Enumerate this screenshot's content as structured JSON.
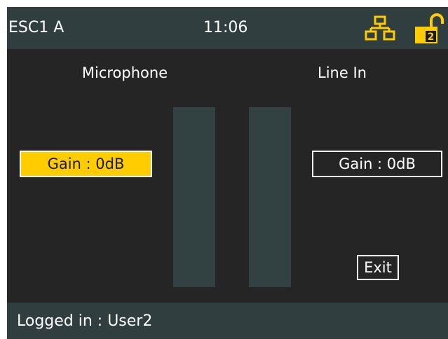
{
  "header": {
    "title": "ESC1 A",
    "time": "11:06",
    "icons": [
      "network-icon",
      "unlocked-user-icon"
    ],
    "user_badge": "2"
  },
  "channels": {
    "microphone": {
      "label": "Microphone",
      "gain": "Gain : 0dB",
      "selected": true,
      "level": 0
    },
    "line_in": {
      "label": "Line In",
      "gain": "Gain : 0dB",
      "selected": false,
      "level": 0
    }
  },
  "actions": {
    "exit_label": "Exit"
  },
  "status": {
    "text": "Logged in : User2"
  },
  "colors": {
    "background": "#252525",
    "bar": "#303e3f",
    "accent": "#ffcc00",
    "meter": "#324142"
  }
}
